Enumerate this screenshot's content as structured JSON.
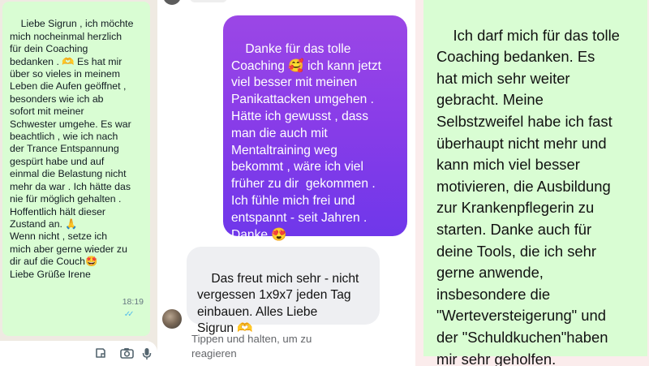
{
  "whatsapp": {
    "message": "Liebe Sigrun , ich möchte\nmich nocheinmal herzlich\nfür dein Coaching\nbedanken . 🫶 Es hat mir\nüber so vieles in meinem\nLeben die Aufen geöffnet ,\nbesonders wie ich ab\nsofort mit meiner\nSchwester umgehe. Es war\nbeachtlich , wie ich nach\nder Trance Entspannung\ngespürt habe und auf\neinmal die Belastung nicht\nmehr da war . Ich hätte das\nnie für möglich gehalten .\nHoffentlich hält dieser\nZustand an. 🙏\nWenn nicht , setze ich\nmich aber gerne wieder zu\ndir auf die Couch🤩\nLiebe Grüße Irene",
    "time": "18:19",
    "ticks": "✓✓",
    "icons": [
      "sticker-icon",
      "camera-icon",
      "microphone-icon"
    ]
  },
  "messenger": {
    "client_message": "Danke für das tolle\nCoaching 🥰 ich kann jetzt\nviel besser mit meinen\nPanikattacken umgehen .\nHätte ich gewusst , dass\nman die auch mit\nMentaltraining weg\nbekommt , wäre ich viel\nfrüher zu dir  gekommen .\nIch fühle mich frei und\nentspannt - seit Jahren .\nDanke 😍",
    "reply_message": "Das freut mich sehr - nicht\nvergessen 1x9x7 jeden Tag\neinbauen. Alles Liebe\nSigrun 🫶",
    "hint": "Tippen und halten, um zu reagieren",
    "colors": {
      "bubble_start": "#9b47e6",
      "bubble_end": "#6f37ea",
      "reply_bg": "#eeeff2"
    }
  },
  "testimonial": {
    "text": "Ich darf mich für das tolle\nCoaching bedanken. Es\nhat mich sehr weiter\ngebracht. Meine\nSelbstzweifel habe ich fast\nüberhaupt nicht mehr und\nkann mich viel besser\nmotivieren, die Ausbildung\nzur Krankenpflegerin zu\nstarten. Danke auch für\ndeine Tools, die ich sehr\ngerne anwende,\ninsbesondere die\n\"Werteversteigerung\" und\nder \"Schuldkuchen\"haben\nmir sehr geholfen.",
    "colors": {
      "background": "#d9fdd3",
      "frame": "#fbecec"
    }
  }
}
